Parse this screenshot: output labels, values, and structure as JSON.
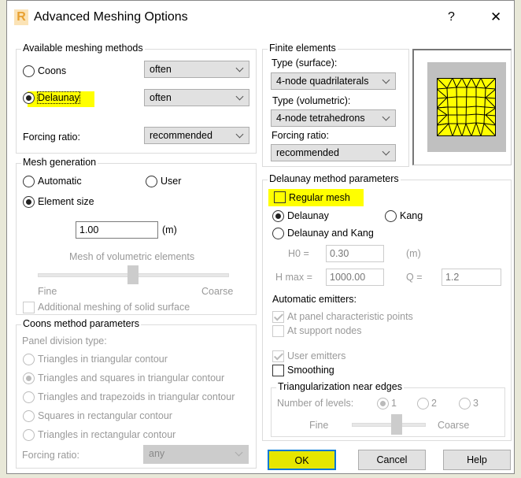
{
  "window": {
    "title": "Advanced Meshing Options",
    "help": "?",
    "close": "✕",
    "icon": "R"
  },
  "meshing_methods": {
    "title": "Available meshing methods",
    "coons": "Coons",
    "coons_value": "often",
    "delaunay": "Delaunay",
    "delaunay_value": "often",
    "forcing_label": "Forcing ratio:",
    "forcing_value": "recommended",
    "selected": "Delaunay"
  },
  "mesh_generation": {
    "title": "Mesh generation",
    "automatic": "Automatic",
    "user": "User",
    "element_size": "Element size",
    "size_value": "1.00",
    "unit": "(m)",
    "volumetric_label": "Mesh of volumetric elements",
    "fine": "Fine",
    "coarse": "Coarse",
    "additional": "Additional meshing of solid surface"
  },
  "coons_params": {
    "title": "Coons method parameters",
    "panel_label": "Panel division type:",
    "options": [
      "Triangles in triangular contour",
      "Triangles and squares in triangular contour",
      "Triangles and trapezoids in triangular contour",
      "Squares in rectangular contour",
      "Triangles in rectangular contour"
    ],
    "selected_index": 1,
    "forcing_label": "Forcing ratio:",
    "forcing_value": "any"
  },
  "finite_elements": {
    "title": "Finite elements",
    "surface_label": "Type (surface):",
    "surface_value": "4-node quadrilaterals",
    "volumetric_label": "Type (volumetric):",
    "volumetric_value": "4-node tetrahedrons",
    "forcing_label": "Forcing ratio:",
    "forcing_value": "recommended"
  },
  "delaunay_params": {
    "title": "Delaunay method parameters",
    "regular_mesh": "Regular mesh",
    "delaunay": "Delaunay",
    "kang": "Kang",
    "delaunay_kang": "Delaunay and Kang",
    "h0_label": "H0 =",
    "h0_value": "0.30",
    "h0_unit": "(m)",
    "hmax_label": "H max =",
    "hmax_value": "1000.00",
    "q_label": "Q =",
    "q_value": "1.2",
    "auto_emitters": "Automatic emitters:",
    "at_panel": "At panel characteristic points",
    "at_support": "At support nodes",
    "user_emitters": "User emitters",
    "smoothing": "Smoothing"
  },
  "triangularization": {
    "title": "Triangularization near edges",
    "levels_label": "Number of levels:",
    "levels": [
      "1",
      "2",
      "3"
    ],
    "fine": "Fine",
    "coarse": "Coarse"
  },
  "buttons": {
    "ok": "OK",
    "cancel": "Cancel",
    "help": "Help"
  },
  "colors": {
    "highlight": "#ffff00",
    "mesh_fill": "#ffff00"
  }
}
